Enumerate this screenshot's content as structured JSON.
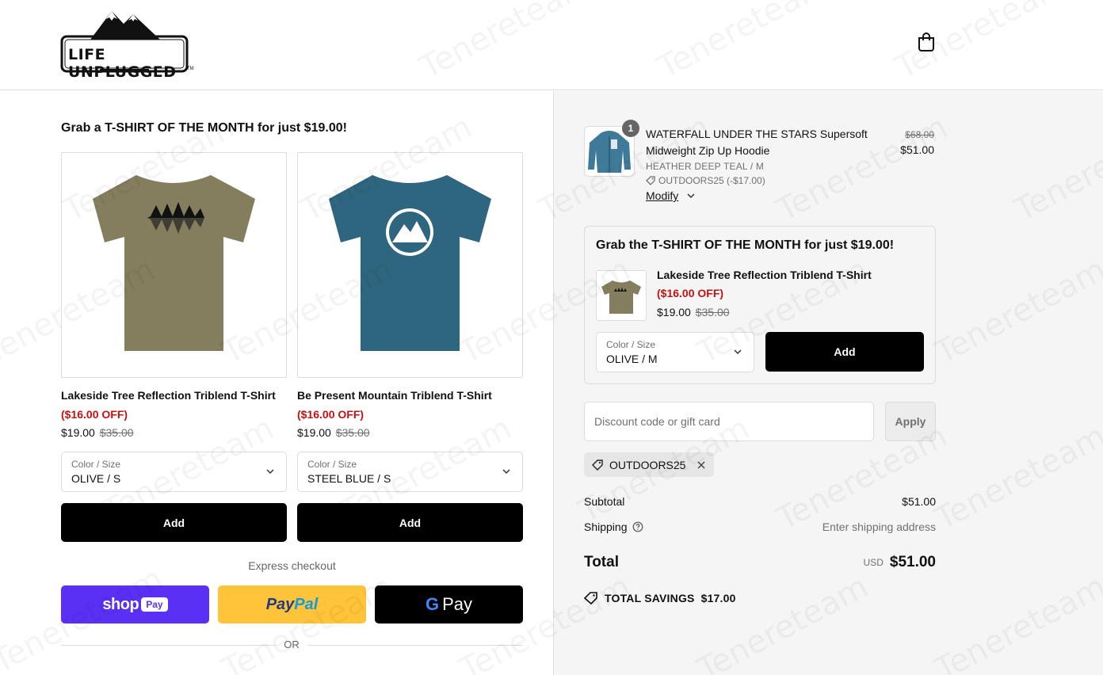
{
  "brand": {
    "name": "LIFE UNPLUGGED",
    "tm": "TM"
  },
  "header": {
    "cart_icon": "shopping-bag-icon"
  },
  "upsell": {
    "heading": "Grab a T-SHIRT OF THE MONTH for just $19.00!",
    "products": [
      {
        "title": "Lakeside Tree Reflection Triblend T-Shirt",
        "discount": "($16.00 OFF)",
        "price": "$19.00",
        "compare_at": "$35.00",
        "select_label": "Color / Size",
        "select_value": "OLIVE / S",
        "add_label": "Add",
        "color": "#847d5e"
      },
      {
        "title": "Be Present Mountain Triblend T-Shirt",
        "discount": "($16.00 OFF)",
        "price": "$19.00",
        "compare_at": "$35.00",
        "select_label": "Color / Size",
        "select_value": "STEEL BLUE / S",
        "add_label": "Add",
        "color": "#2e6680"
      }
    ]
  },
  "express": {
    "label": "Express checkout",
    "shop_pay": {
      "word": "shop",
      "badge": "Pay"
    },
    "paypal": {
      "word1": "Pay",
      "word2": "Pal"
    },
    "gpay": {
      "g": "G",
      "word": "Pay"
    },
    "or": "OR"
  },
  "order": {
    "line_item": {
      "quantity": "1",
      "title": "WATERFALL UNDER THE STARS Supersoft Midweight Zip Up Hoodie",
      "variant": "HEATHER DEEP TEAL / M",
      "discount": "OUTDOORS25 (-$17.00)",
      "modify": "Modify",
      "compare_at": "$68.00",
      "price": "$51.00"
    },
    "upsell_box": {
      "heading": "Grab the T-SHIRT OF THE MONTH for just $19.00!",
      "title": "Lakeside Tree Reflection Triblend T-Shirt",
      "discount": "($16.00 OFF)",
      "price": "$19.00",
      "compare_at": "$35.00",
      "select_label": "Color / Size",
      "select_value": "OLIVE / M",
      "add_label": "Add"
    },
    "discount_field": {
      "placeholder": "Discount code or gift card",
      "apply": "Apply"
    },
    "applied_code": "OUTDOORS25",
    "summary": {
      "subtotal_label": "Subtotal",
      "subtotal": "$51.00",
      "shipping_label": "Shipping",
      "shipping_value": "Enter shipping address",
      "total_label": "Total",
      "currency": "USD",
      "total": "$51.00",
      "savings_label": "TOTAL SAVINGS",
      "savings": "$17.00"
    }
  },
  "watermark": "Tenereteam",
  "colors": {
    "sale_red": "#c41111",
    "shop_pay": "#5a31f4",
    "paypal": "#ffc439"
  }
}
